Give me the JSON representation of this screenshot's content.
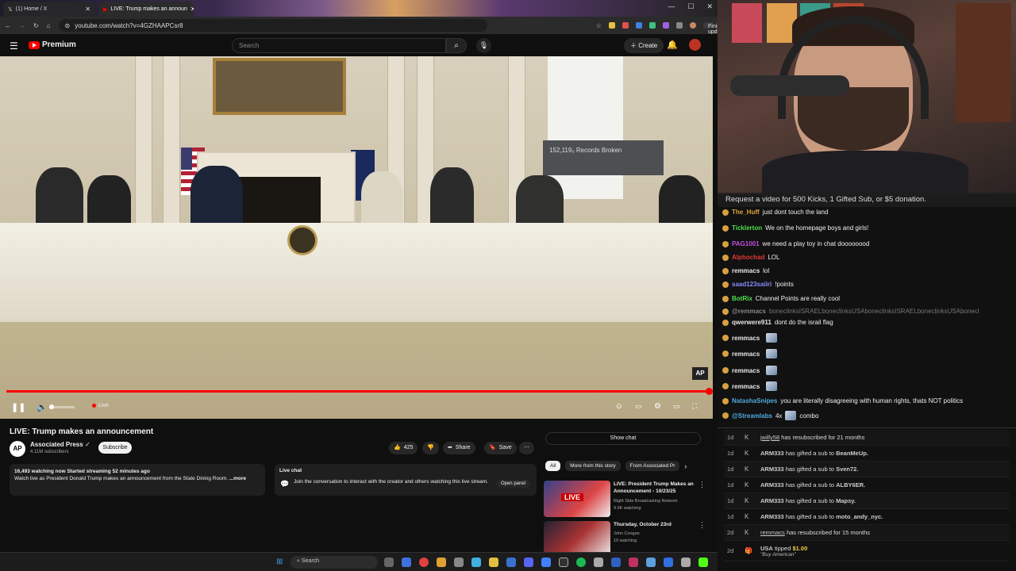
{
  "browser": {
    "tabs": [
      {
        "title": "(1) Home / X"
      },
      {
        "title": "LIVE: Trump makes an announ"
      }
    ],
    "url": "youtube.com/watch?v=4GZHAAPCsr8",
    "finish_update": "Finish update"
  },
  "youtube": {
    "brand": "Premium",
    "search_placeholder": "Search",
    "create_label": "Create",
    "video": {
      "screen_text": "152,119₀ Records Broken",
      "ap_logo": "AP",
      "live_label": "Live"
    },
    "title": "LIVE: Trump makes an announcement",
    "channel": {
      "name": "Associated Press",
      "subscribers": "4.11M subscribers",
      "avatar_text": "AP",
      "subscribe_label": "Subscribe"
    },
    "actions": {
      "likes": "425",
      "share": "Share",
      "save": "Save",
      "more": "⋯"
    },
    "description": {
      "stats": "16,493 watching now  Started streaming 52 minutes ago",
      "text": "Watch live as President Donald Trump makes an announcement from the State Dining Room.",
      "more": "...more"
    },
    "live_chat": {
      "title": "Live chat",
      "message": "Join the conversation to interact with the creator and others watching this live stream.",
      "open_panel": "Open panel"
    },
    "show_chat": "Show chat",
    "chips": [
      "All",
      "More from this story",
      "From Associated Pr"
    ],
    "recommendations": [
      {
        "title": "LIVE: President Trump Makes an Announcement - 10/23/25",
        "channel": "Right Side Broadcasting Network",
        "views": "9.5K watching",
        "badge": "LIVE"
      },
      {
        "title": "Thursday, October 23rd",
        "channel": "John Coogan",
        "views": "10 watching",
        "badge": ""
      }
    ]
  },
  "taskbar": {
    "search": "Search"
  },
  "stream": {
    "banner": "Request a video for 500 Kicks, 1 Gifted Sub, or $5 donation.",
    "chat": [
      {
        "user": "The_Huff",
        "text": "just dont touch the land",
        "color": "#e0a33a"
      },
      {
        "user": "Ticklerton",
        "text": "We on the homepage boys and girls!",
        "color": "#4fe04f"
      },
      {
        "user": "PAG1001",
        "text": "we need a play toy in chat doooooood",
        "color": "#c04fe0"
      },
      {
        "user": "Alphochad",
        "text": "LOL",
        "color": "#e03a3a"
      },
      {
        "user": "remmacs",
        "text": "lol",
        "color": "#e8e8e8"
      },
      {
        "user": "saad123saiiri",
        "text": "!points",
        "color": "#8a8aff"
      },
      {
        "user": "BotRix",
        "text": "Channel Points are really cool",
        "color": "#4fe04f"
      },
      {
        "user": "@remmacs",
        "text": "boneclinksISRAELboneclinksUSAboneclinksISRAELboneclinksUSAbonecl",
        "color": "#888888"
      },
      {
        "user": "qwerwere911",
        "text": "dont do the israil flag",
        "color": "#e8e8e8"
      },
      {
        "user": "remmacs",
        "text": "",
        "color": "#e8e8e8"
      },
      {
        "user": "remmacs",
        "text": "",
        "color": "#e8e8e8"
      },
      {
        "user": "remmacs",
        "text": "",
        "color": "#e8e8e8"
      },
      {
        "user": "remmacs",
        "text": "",
        "color": "#e8e8e8"
      },
      {
        "user": "NatashaSnipes",
        "text": "you are literally disagreeing with human rights, thats NOT politics",
        "color": "#4faae0"
      },
      {
        "user": "@Streamlabs",
        "text": "4x",
        "color": "#4faae0",
        "suffix": "combo"
      }
    ],
    "events": [
      {
        "age": "1d",
        "user": "jwilly58",
        "text": "has resubscribed for 21 months"
      },
      {
        "age": "1d",
        "user": "ARM333",
        "text": "has gifted a sub to",
        "target": "BeanMeUp."
      },
      {
        "age": "1d",
        "user": "ARM333",
        "text": "has gifted a sub to",
        "target": "Sven72."
      },
      {
        "age": "1d",
        "user": "ARM333",
        "text": "has gifted a sub to",
        "target": "ALBY6ER."
      },
      {
        "age": "1d",
        "user": "ARM333",
        "text": "has gifted a sub to",
        "target": "Mapsy."
      },
      {
        "age": "1d",
        "user": "ARM333",
        "text": "has gifted a sub to",
        "target": "moto_andy_nyc."
      },
      {
        "age": "2d",
        "user": "remmacs",
        "text": "has resubscribed for 15 months"
      },
      {
        "age": "2d",
        "user": "USA",
        "text": "tipped",
        "amount": "$1.00",
        "message": "\"Buy American\""
      }
    ]
  }
}
